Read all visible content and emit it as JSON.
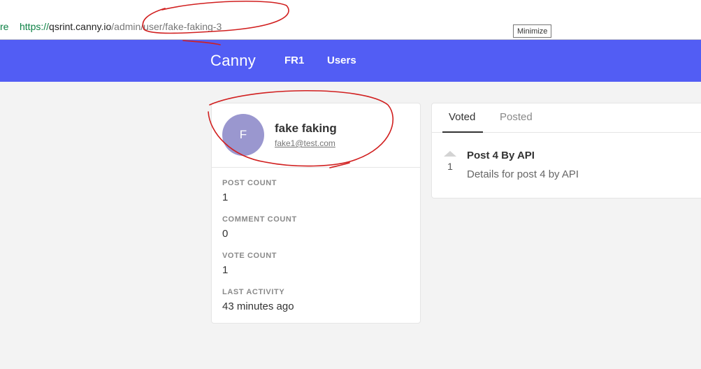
{
  "browser": {
    "address_fragment": "re",
    "url_scheme": "https://",
    "url_host": "qsrint.canny.io",
    "url_path": "/admin/user/fake-faking-3",
    "tooltip": "Minimize"
  },
  "header": {
    "logo": "Canny",
    "nav": [
      "FR1",
      "Users"
    ],
    "background": "#525df4"
  },
  "user": {
    "avatar_initial": "F",
    "name": "fake faking",
    "email": "fake1@test.com",
    "stats": [
      {
        "label": "POST COUNT",
        "value": "1"
      },
      {
        "label": "COMMENT COUNT",
        "value": "0"
      },
      {
        "label": "VOTE COUNT",
        "value": "1"
      },
      {
        "label": "LAST ACTIVITY",
        "value": "43 minutes ago"
      }
    ]
  },
  "activity": {
    "tabs": [
      "Voted",
      "Posted"
    ],
    "active_tab": "Voted",
    "posts": [
      {
        "votes": "1",
        "title": "Post 4 By API",
        "details": "Details for post 4 by API",
        "vote_icon": "upvote-arrow-icon"
      }
    ]
  },
  "annotation_color": "#d11f1f"
}
